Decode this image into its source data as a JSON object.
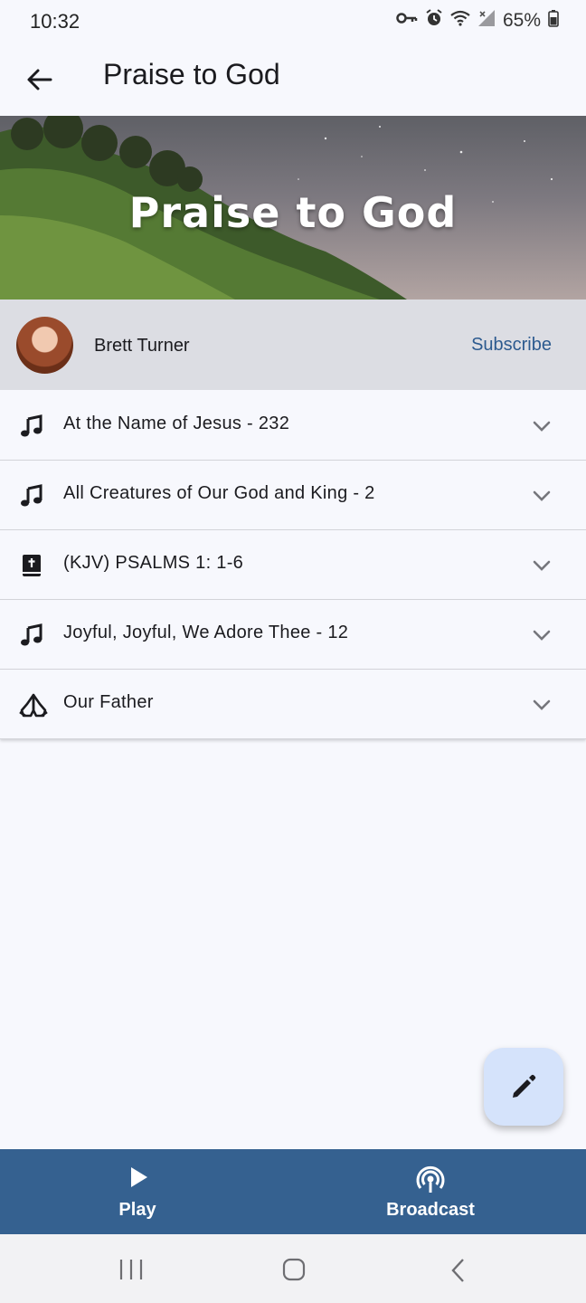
{
  "status_bar": {
    "time": "10:32",
    "battery": "65%",
    "icons": [
      "key-icon",
      "alarm-icon",
      "wifi-icon",
      "signal-icon",
      "battery-icon"
    ]
  },
  "app_bar": {
    "title": "Praise to God",
    "back_icon": "arrow-back-icon"
  },
  "hero": {
    "title": "Praise to God"
  },
  "author": {
    "name": "Brett Turner",
    "subscribe_label": "Subscribe"
  },
  "items": [
    {
      "icon": "music-note-icon",
      "label": "At the Name of Jesus - 232"
    },
    {
      "icon": "music-note-icon",
      "label": "All Creatures of Our God and King - 2"
    },
    {
      "icon": "bible-icon",
      "label": "(KJV) PSALMS 1: 1-6"
    },
    {
      "icon": "music-note-icon",
      "label": "Joyful, Joyful, We Adore Thee - 12"
    },
    {
      "icon": "praying-hands-icon",
      "label": "Our Father"
    }
  ],
  "fab": {
    "icon": "edit-pencil-icon"
  },
  "bottom_nav": {
    "play_label": "Play",
    "broadcast_label": "Broadcast"
  },
  "colors": {
    "background": "#f7f8fd",
    "author_bar": "#dcdde3",
    "accent": "#356190",
    "subscribe": "#2c5a8f",
    "fab": "#d5e3fb"
  }
}
